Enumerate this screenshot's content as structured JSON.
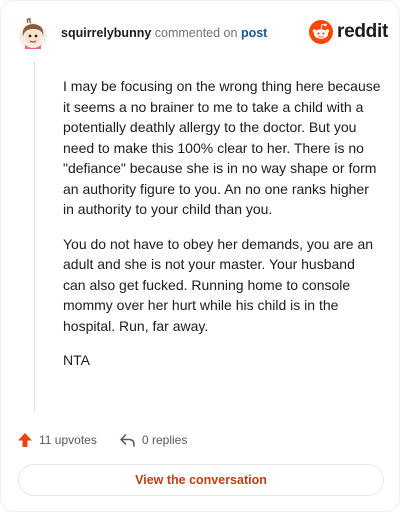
{
  "header": {
    "username": "squirrelybunny",
    "action_text": "commented on",
    "post_link": "post",
    "logo_text": "reddit"
  },
  "comment": {
    "paragraphs": [
      "I may be focusing on the wrong thing here because it seems a no brainer to me to take a child with a potentially deathly allergy to the doctor. But you need to make this 100% clear to her. There is no \"defiance\" because she is in no way shape or form an authority figure to you. An no one ranks higher in authority to your child than you.",
      "You do not have to obey her demands, you are an adult and she is not your master. Your husband can also get fucked. Running home to console mommy over her hurt while his child is in the hospital. Run, far away.",
      "NTA"
    ]
  },
  "actions": {
    "upvotes_label": "11 upvotes",
    "replies_label": "0 replies"
  },
  "cta": {
    "label": "View the conversation"
  },
  "colors": {
    "brand": "#ff4500",
    "upvote": "#e8421a",
    "link": "#0f5a94",
    "cta_text": "#c04013"
  },
  "icons": {
    "avatar": "avatar-icon",
    "logo": "reddit-logo-icon",
    "upvote": "upvote-arrow-icon",
    "reply": "reply-arrow-icon"
  }
}
